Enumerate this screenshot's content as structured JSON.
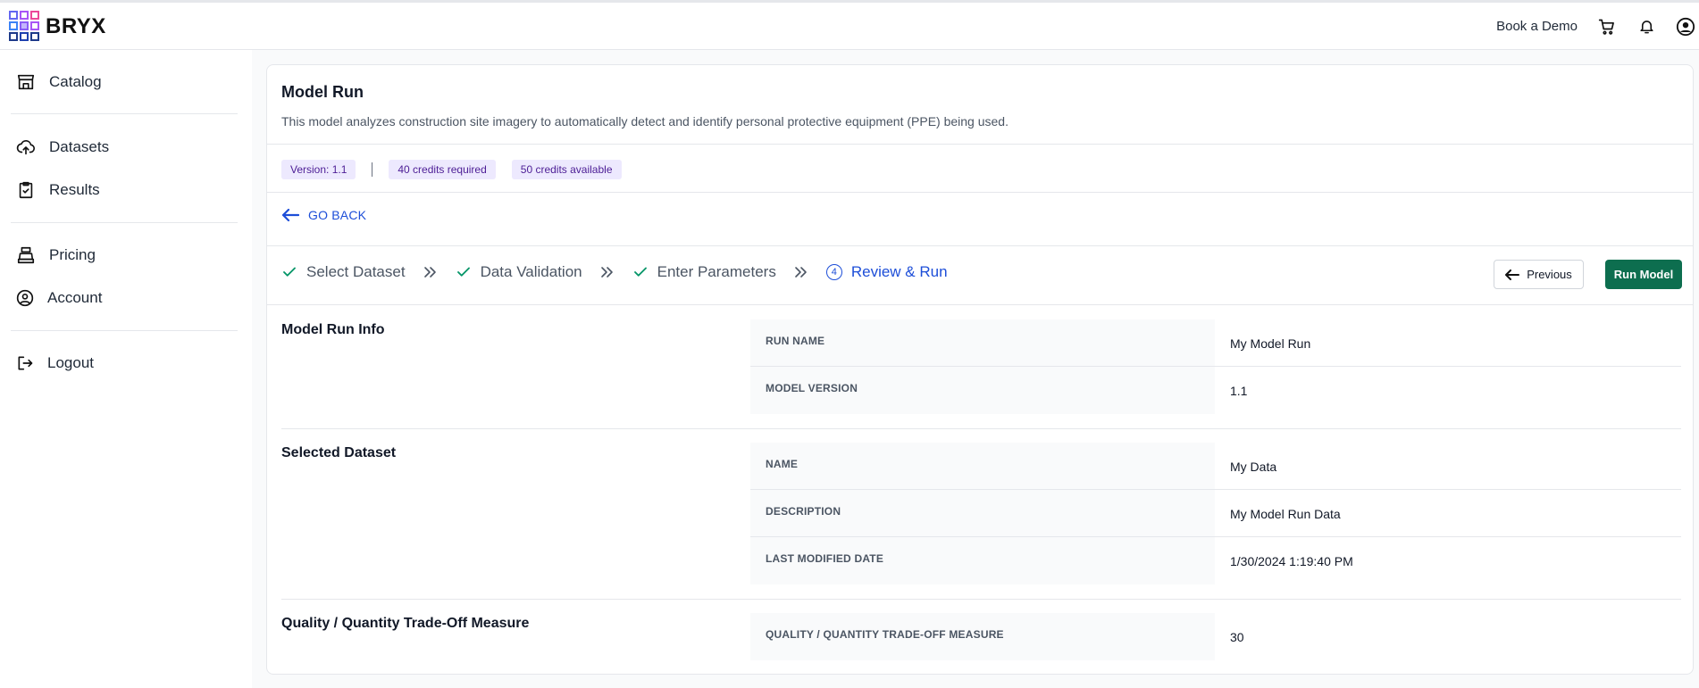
{
  "brand": {
    "name": "BRYX"
  },
  "header": {
    "book_demo": "Book a Demo",
    "icons": [
      "cart-icon",
      "bell-icon",
      "user-icon"
    ]
  },
  "sidebar": {
    "items": [
      {
        "label": "Catalog",
        "icon": "store-icon"
      },
      {
        "label": "Datasets",
        "icon": "cloud-upload-icon"
      },
      {
        "label": "Results",
        "icon": "clipboard-check-icon"
      },
      {
        "label": "Pricing",
        "icon": "cash-register-icon"
      },
      {
        "label": "Account",
        "icon": "user-circle-icon"
      },
      {
        "label": "Logout",
        "icon": "logout-icon"
      }
    ]
  },
  "card": {
    "title": "Model Run",
    "description": "This model analyzes construction site imagery to automatically detect and identify personal protective equipment (PPE) being used.",
    "badges": {
      "version": "Version: 1.1",
      "credits_required": "40 credits required",
      "credits_available": "50 credits available"
    },
    "go_back": "GO BACK"
  },
  "stepper": {
    "steps": [
      {
        "label": "Select Dataset",
        "status": "complete"
      },
      {
        "label": "Data Validation",
        "status": "complete"
      },
      {
        "label": "Enter Parameters",
        "status": "complete"
      },
      {
        "label": "Review & Run",
        "status": "active",
        "number": "4"
      }
    ],
    "previous_label": "Previous",
    "run_label": "Run Model"
  },
  "sections": {
    "run_info": {
      "title": "Model Run Info",
      "rows": [
        {
          "key": "RUN NAME",
          "value": "My Model Run"
        },
        {
          "key": "MODEL VERSION",
          "value": "1.1"
        }
      ]
    },
    "dataset": {
      "title": "Selected Dataset",
      "rows": [
        {
          "key": "NAME",
          "value": "My Data"
        },
        {
          "key": "DESCRIPTION",
          "value": "My Model Run Data"
        },
        {
          "key": "LAST MODIFIED DATE",
          "value": "1/30/2024 1:19:40 PM"
        }
      ]
    },
    "tradeoff": {
      "title": "Quality / Quantity Trade-Off Measure",
      "rows": [
        {
          "key": "QUALITY / QUANTITY TRADE-OFF MEASURE",
          "value": "30"
        }
      ]
    }
  },
  "colors": {
    "primary_blue": "#1d4ed8",
    "run_green": "#0d6e4f",
    "badge_bg": "#ede9fe",
    "check_green": "#059669"
  }
}
